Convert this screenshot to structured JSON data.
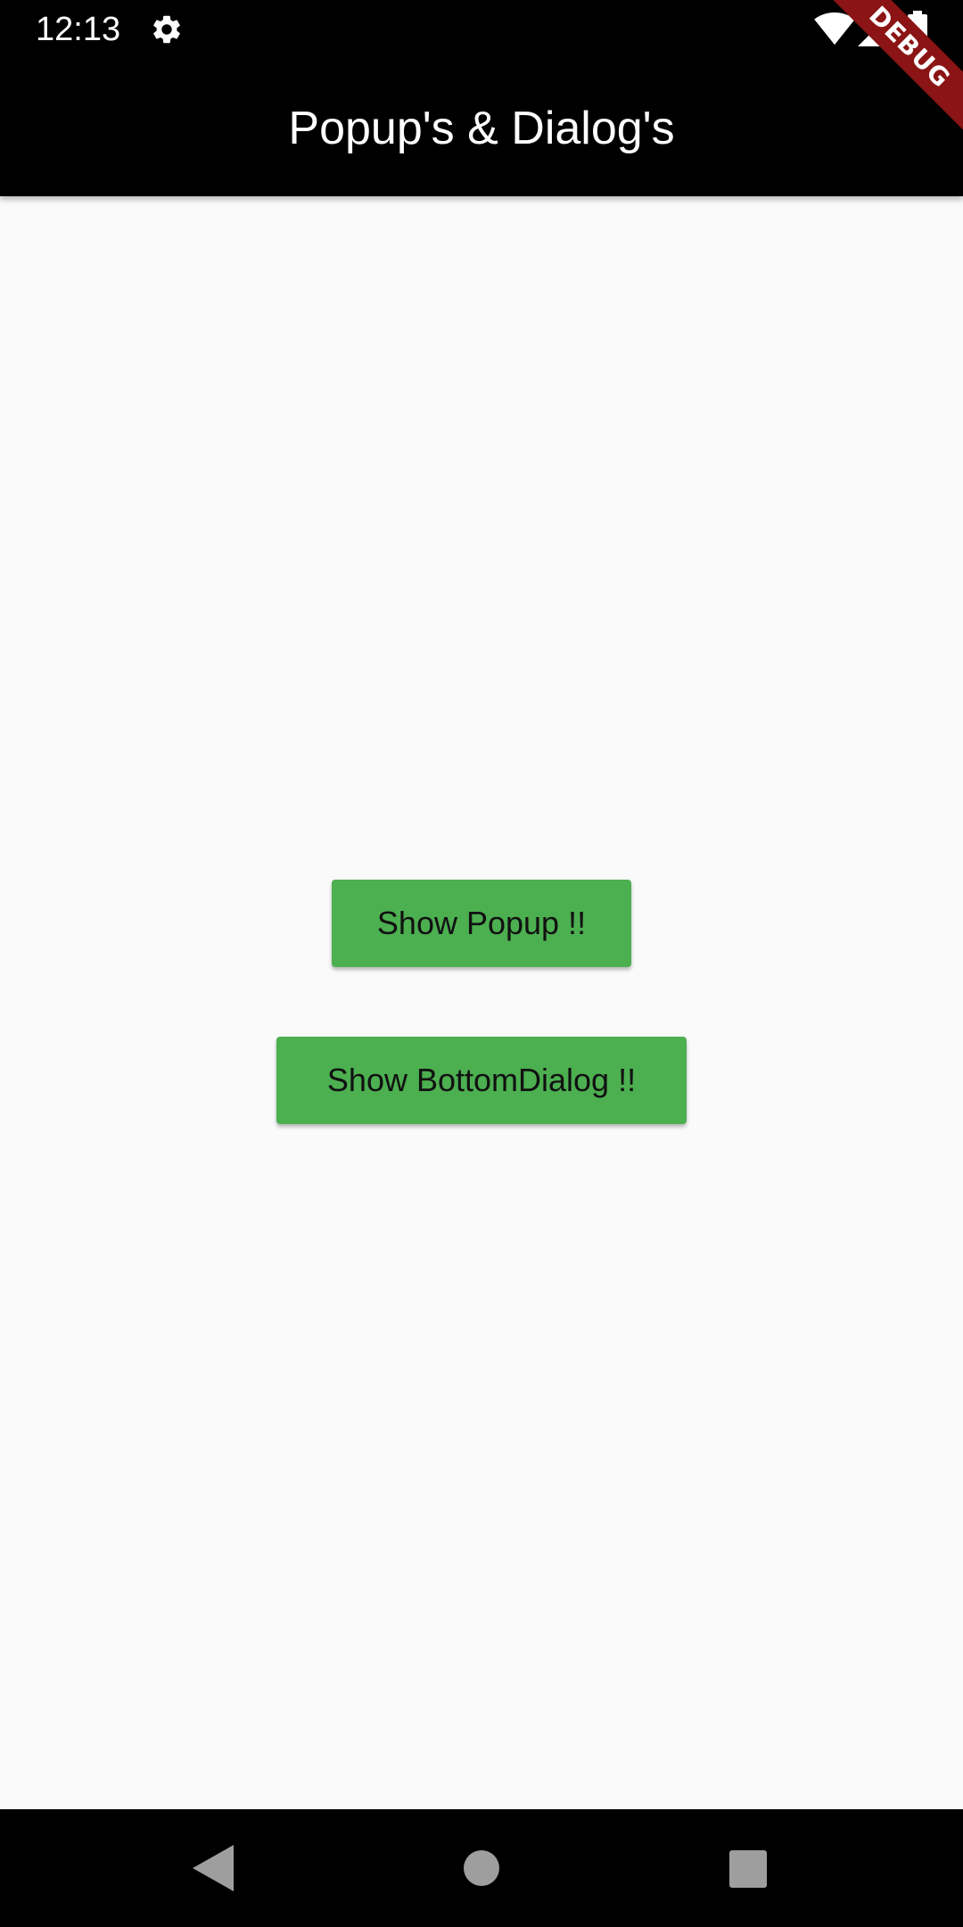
{
  "status_bar": {
    "time": "12:13",
    "icons": [
      "gear-icon",
      "wifi-icon",
      "signal-icon",
      "battery-icon"
    ]
  },
  "app_bar": {
    "title": "Popup's & Dialog's"
  },
  "debug_banner": {
    "label": "DEBUG",
    "color": "#8b1414"
  },
  "main": {
    "buttons": [
      {
        "label": "Show Popup !!"
      },
      {
        "label": "Show BottomDialog !!"
      }
    ],
    "button_color": "#4caf50"
  },
  "nav_bar": {
    "icons": [
      "back-icon",
      "home-icon",
      "recents-icon"
    ]
  }
}
